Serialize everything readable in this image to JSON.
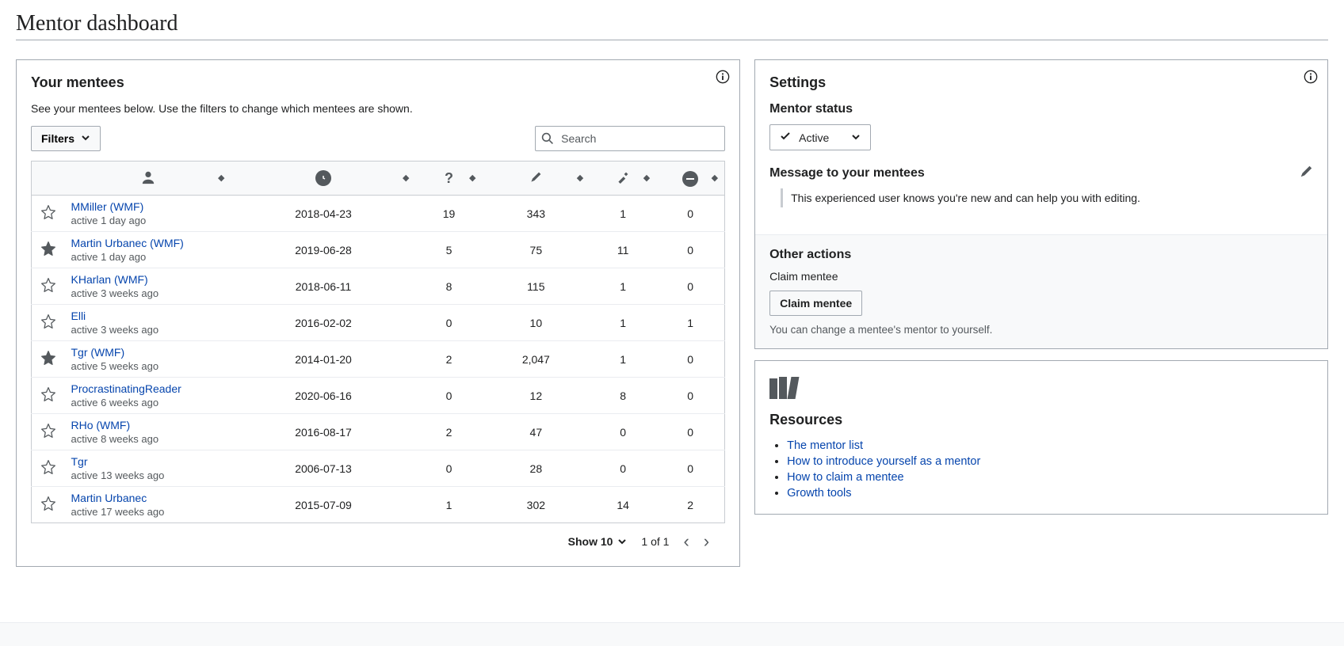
{
  "page_title": "Mentor dashboard",
  "mentees_card": {
    "title": "Your mentees",
    "hint": "See your mentees below. Use the filters to change which mentees are shown.",
    "filters_label": "Filters",
    "search_placeholder": "Search",
    "pager": {
      "show_label": "Show 10",
      "page_label": "1 of 1"
    }
  },
  "rows": [
    {
      "starred": false,
      "name": "MMiller (WMF)",
      "active": "active 1 day ago",
      "date": "2018-04-23",
      "q": "19",
      "edits": "343",
      "rev": "1",
      "blocks": "0"
    },
    {
      "starred": true,
      "name": "Martin Urbanec (WMF)",
      "active": "active 1 day ago",
      "date": "2019-06-28",
      "q": "5",
      "edits": "75",
      "rev": "11",
      "blocks": "0"
    },
    {
      "starred": false,
      "name": "KHarlan (WMF)",
      "active": "active 3 weeks ago",
      "date": "2018-06-11",
      "q": "8",
      "edits": "115",
      "rev": "1",
      "blocks": "0"
    },
    {
      "starred": false,
      "name": "Elli",
      "active": "active 3 weeks ago",
      "date": "2016-02-02",
      "q": "0",
      "edits": "10",
      "rev": "1",
      "blocks": "1"
    },
    {
      "starred": true,
      "name": "Tgr (WMF)",
      "active": "active 5 weeks ago",
      "date": "2014-01-20",
      "q": "2",
      "edits": "2,047",
      "rev": "1",
      "blocks": "0"
    },
    {
      "starred": false,
      "name": "ProcrastinatingReader",
      "active": "active 6 weeks ago",
      "date": "2020-06-16",
      "q": "0",
      "edits": "12",
      "rev": "8",
      "blocks": "0"
    },
    {
      "starred": false,
      "name": "RHo (WMF)",
      "active": "active 8 weeks ago",
      "date": "2016-08-17",
      "q": "2",
      "edits": "47",
      "rev": "0",
      "blocks": "0"
    },
    {
      "starred": false,
      "name": "Tgr",
      "active": "active 13 weeks ago",
      "date": "2006-07-13",
      "q": "0",
      "edits": "28",
      "rev": "0",
      "blocks": "0"
    },
    {
      "starred": false,
      "name": "Martin Urbanec",
      "active": "active 17 weeks ago",
      "date": "2015-07-09",
      "q": "1",
      "edits": "302",
      "rev": "14",
      "blocks": "2"
    }
  ],
  "settings": {
    "title": "Settings",
    "status_label": "Mentor status",
    "status_value": "Active",
    "message_label": "Message to your mentees",
    "message_text": "This experienced user knows you're new and can help you with editing.",
    "other_actions_title": "Other actions",
    "claim_label": "Claim mentee",
    "claim_button": "Claim mentee",
    "claim_desc": "You can change a mentee's mentor to yourself."
  },
  "resources": {
    "title": "Resources",
    "links": [
      "The mentor list",
      "How to introduce yourself as a mentor",
      "How to claim a mentee",
      "Growth tools"
    ]
  }
}
